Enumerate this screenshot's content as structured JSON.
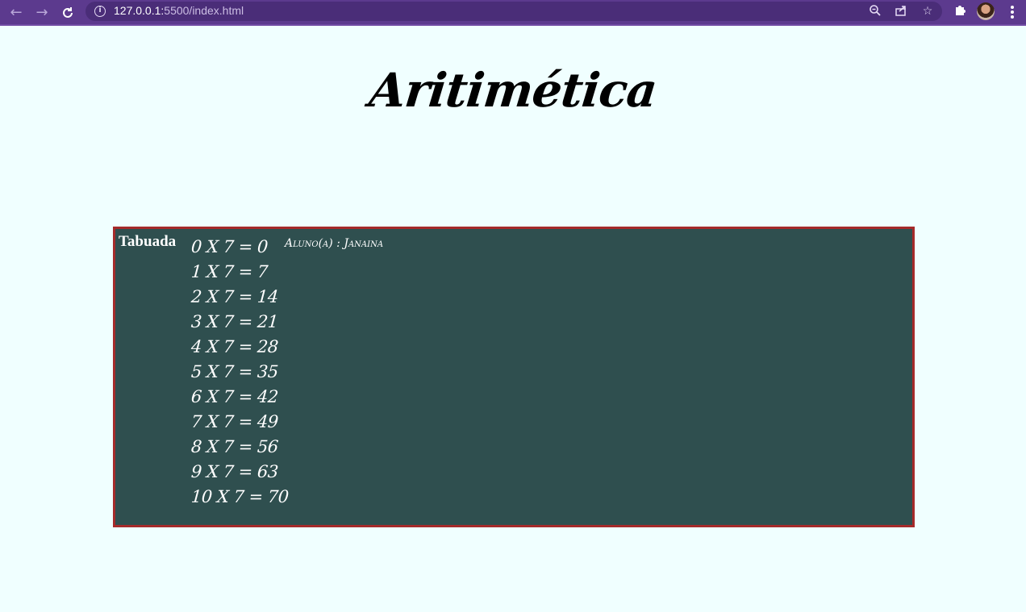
{
  "browser": {
    "url_host": "127.0.0.1:",
    "url_rest": "5500/index.html",
    "icons": {
      "back": "arrow-left-icon",
      "forward": "arrow-right-icon",
      "reload": "reload-icon",
      "site_info": "info-icon",
      "zoom": "zoom-out-icon",
      "share": "share-icon",
      "bookmark": "star-icon",
      "extensions": "puzzle-icon",
      "menu": "more-vert-icon"
    },
    "accent_color": "#5c3a8e"
  },
  "page": {
    "title": "Aritimética",
    "background_color": "#f0ffff",
    "board": {
      "label": "Tabuada",
      "student": "Aluno(a) : Janaina",
      "background_color": "#2f4f4f",
      "border_color": "#a52a2a",
      "rows": [
        "0 X 7 = 0",
        "1 X 7 = 7",
        "2 X 7 = 14",
        "3 X 7 = 21",
        "4 X 7 = 28",
        "5 X 7 = 35",
        "6 X 7 = 42",
        "7 X 7 = 49",
        "8 X 7 = 56",
        "9 X 7 = 63",
        "10 X 7 = 70"
      ]
    }
  }
}
